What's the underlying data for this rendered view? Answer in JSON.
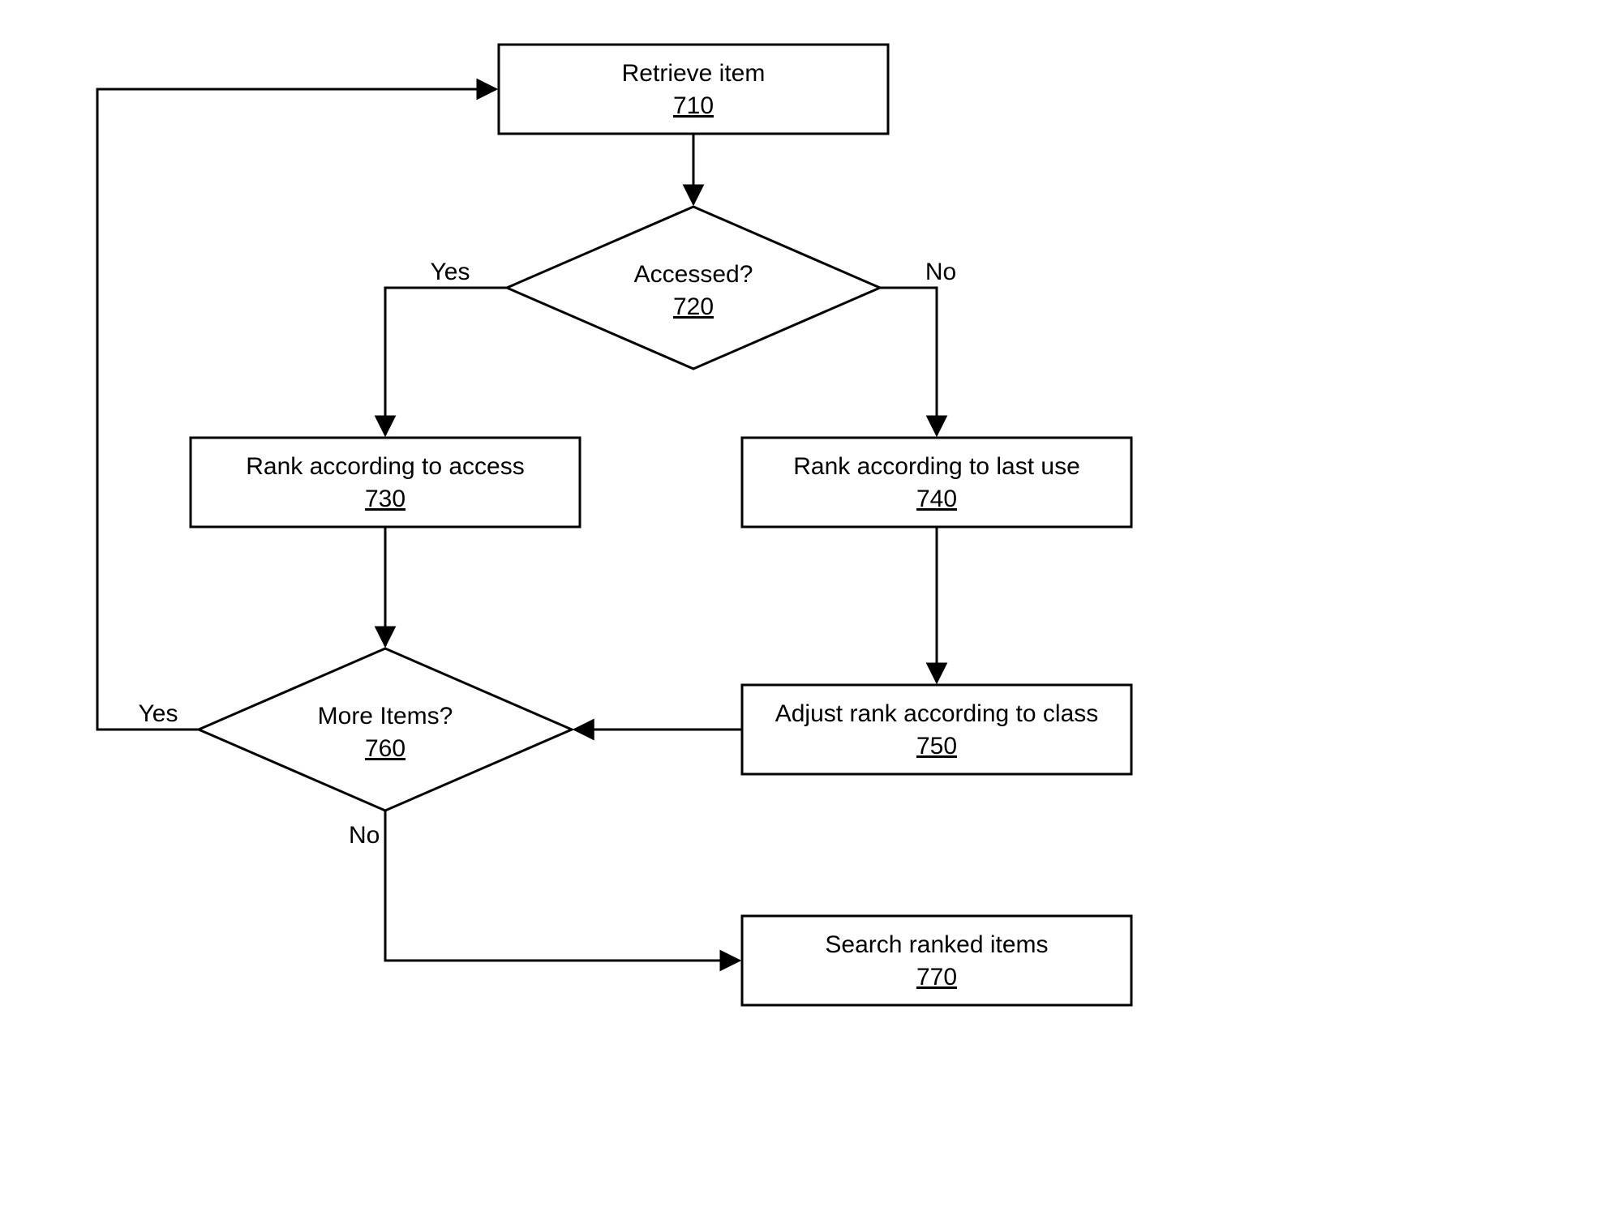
{
  "nodes": {
    "n710": {
      "label": "Retrieve item",
      "ref": "710"
    },
    "n720": {
      "label": "Accessed?",
      "ref": "720"
    },
    "n730": {
      "label": "Rank according to access",
      "ref": "730"
    },
    "n740": {
      "label": "Rank according to last use",
      "ref": "740"
    },
    "n750": {
      "label": "Adjust rank according to class",
      "ref": "750"
    },
    "n760": {
      "label": "More Items?",
      "ref": "760"
    },
    "n770": {
      "label": "Search ranked items",
      "ref": "770"
    }
  },
  "edgeLabels": {
    "e720_yes": "Yes",
    "e720_no": "No",
    "e760_yes": "Yes",
    "e760_no": "No"
  }
}
